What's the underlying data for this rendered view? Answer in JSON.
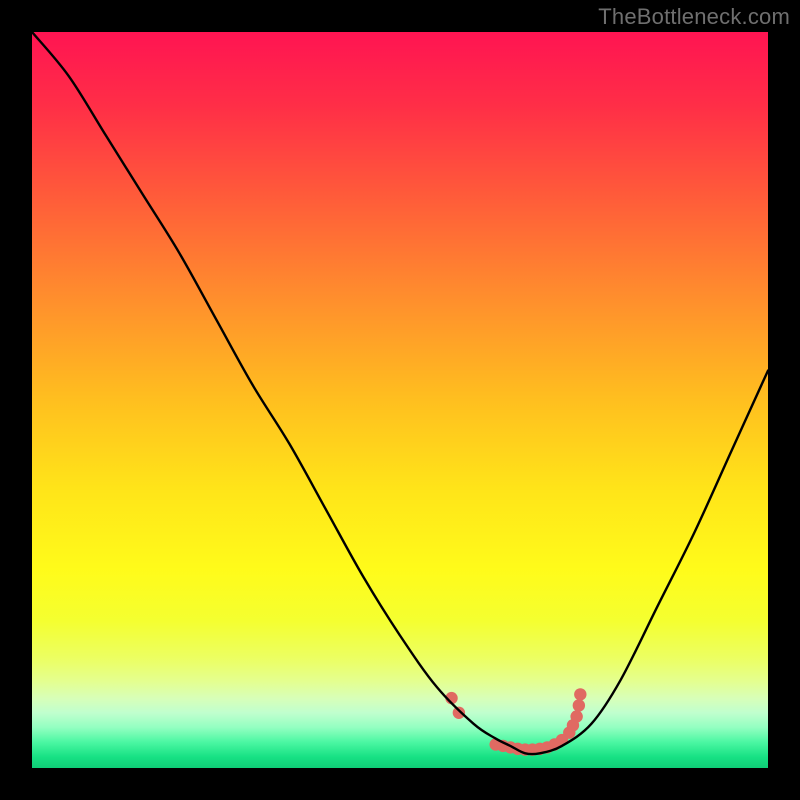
{
  "watermark": "TheBottleneck.com",
  "chart_data": {
    "type": "line",
    "title": "",
    "xlabel": "",
    "ylabel": "",
    "xlim": [
      0,
      100
    ],
    "ylim": [
      0,
      100
    ],
    "grid": false,
    "series": [
      {
        "name": "bottleneck-curve",
        "x": [
          0,
          5,
          10,
          15,
          20,
          25,
          30,
          35,
          40,
          45,
          50,
          55,
          60,
          63,
          65,
          67,
          69,
          72,
          76,
          80,
          85,
          90,
          95,
          100
        ],
        "values": [
          100,
          94,
          86,
          78,
          70,
          61,
          52,
          44,
          35,
          26,
          18,
          11,
          6,
          4,
          3,
          2,
          2,
          3,
          6,
          12,
          22,
          32,
          43,
          54
        ]
      }
    ],
    "highlight_region": {
      "name": "optimal-range-dots",
      "x": [
        57,
        58,
        63,
        64,
        65,
        66,
        67,
        68,
        69,
        70,
        71,
        72,
        73,
        73.5,
        74,
        74.3,
        74.5
      ],
      "values": [
        9.5,
        7.5,
        3.2,
        3.0,
        2.8,
        2.6,
        2.5,
        2.5,
        2.6,
        2.8,
        3.2,
        3.8,
        4.8,
        5.8,
        7.0,
        8.5,
        10.0
      ],
      "color": "#e06a62"
    },
    "background_gradient_stops": [
      {
        "pos": 0.0,
        "color": "#ff1452"
      },
      {
        "pos": 0.1,
        "color": "#ff2e47"
      },
      {
        "pos": 0.22,
        "color": "#ff5a3a"
      },
      {
        "pos": 0.35,
        "color": "#ff8a2e"
      },
      {
        "pos": 0.5,
        "color": "#ffbf1f"
      },
      {
        "pos": 0.62,
        "color": "#ffe419"
      },
      {
        "pos": 0.73,
        "color": "#fffb1a"
      },
      {
        "pos": 0.8,
        "color": "#f4ff30"
      },
      {
        "pos": 0.85,
        "color": "#ecff61"
      },
      {
        "pos": 0.88,
        "color": "#e5ff8c"
      },
      {
        "pos": 0.905,
        "color": "#d8ffb8"
      },
      {
        "pos": 0.925,
        "color": "#c0ffce"
      },
      {
        "pos": 0.945,
        "color": "#93ffc1"
      },
      {
        "pos": 0.965,
        "color": "#4bf7a2"
      },
      {
        "pos": 0.985,
        "color": "#17e184"
      },
      {
        "pos": 1.0,
        "color": "#0fce77"
      }
    ]
  }
}
